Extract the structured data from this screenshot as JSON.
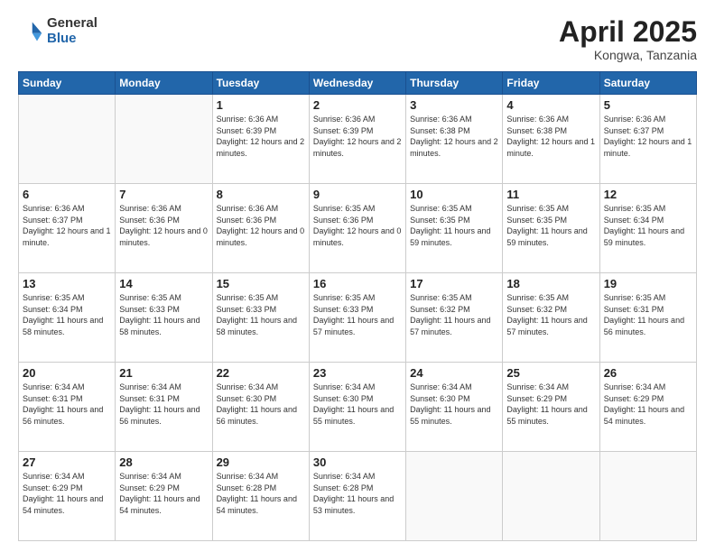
{
  "header": {
    "logo_general": "General",
    "logo_blue": "Blue",
    "title": "April 2025",
    "subtitle": "Kongwa, Tanzania"
  },
  "weekdays": [
    "Sunday",
    "Monday",
    "Tuesday",
    "Wednesday",
    "Thursday",
    "Friday",
    "Saturday"
  ],
  "weeks": [
    [
      {
        "day": "",
        "empty": true
      },
      {
        "day": "",
        "empty": true
      },
      {
        "day": "1",
        "sunrise": "6:36 AM",
        "sunset": "6:39 PM",
        "daylight": "12 hours and 2 minutes."
      },
      {
        "day": "2",
        "sunrise": "6:36 AM",
        "sunset": "6:39 PM",
        "daylight": "12 hours and 2 minutes."
      },
      {
        "day": "3",
        "sunrise": "6:36 AM",
        "sunset": "6:38 PM",
        "daylight": "12 hours and 2 minutes."
      },
      {
        "day": "4",
        "sunrise": "6:36 AM",
        "sunset": "6:38 PM",
        "daylight": "12 hours and 1 minute."
      },
      {
        "day": "5",
        "sunrise": "6:36 AM",
        "sunset": "6:37 PM",
        "daylight": "12 hours and 1 minute."
      }
    ],
    [
      {
        "day": "6",
        "sunrise": "6:36 AM",
        "sunset": "6:37 PM",
        "daylight": "12 hours and 1 minute."
      },
      {
        "day": "7",
        "sunrise": "6:36 AM",
        "sunset": "6:36 PM",
        "daylight": "12 hours and 0 minutes."
      },
      {
        "day": "8",
        "sunrise": "6:36 AM",
        "sunset": "6:36 PM",
        "daylight": "12 hours and 0 minutes."
      },
      {
        "day": "9",
        "sunrise": "6:35 AM",
        "sunset": "6:36 PM",
        "daylight": "12 hours and 0 minutes."
      },
      {
        "day": "10",
        "sunrise": "6:35 AM",
        "sunset": "6:35 PM",
        "daylight": "11 hours and 59 minutes."
      },
      {
        "day": "11",
        "sunrise": "6:35 AM",
        "sunset": "6:35 PM",
        "daylight": "11 hours and 59 minutes."
      },
      {
        "day": "12",
        "sunrise": "6:35 AM",
        "sunset": "6:34 PM",
        "daylight": "11 hours and 59 minutes."
      }
    ],
    [
      {
        "day": "13",
        "sunrise": "6:35 AM",
        "sunset": "6:34 PM",
        "daylight": "11 hours and 58 minutes."
      },
      {
        "day": "14",
        "sunrise": "6:35 AM",
        "sunset": "6:33 PM",
        "daylight": "11 hours and 58 minutes."
      },
      {
        "day": "15",
        "sunrise": "6:35 AM",
        "sunset": "6:33 PM",
        "daylight": "11 hours and 58 minutes."
      },
      {
        "day": "16",
        "sunrise": "6:35 AM",
        "sunset": "6:33 PM",
        "daylight": "11 hours and 57 minutes."
      },
      {
        "day": "17",
        "sunrise": "6:35 AM",
        "sunset": "6:32 PM",
        "daylight": "11 hours and 57 minutes."
      },
      {
        "day": "18",
        "sunrise": "6:35 AM",
        "sunset": "6:32 PM",
        "daylight": "11 hours and 57 minutes."
      },
      {
        "day": "19",
        "sunrise": "6:35 AM",
        "sunset": "6:31 PM",
        "daylight": "11 hours and 56 minutes."
      }
    ],
    [
      {
        "day": "20",
        "sunrise": "6:34 AM",
        "sunset": "6:31 PM",
        "daylight": "11 hours and 56 minutes."
      },
      {
        "day": "21",
        "sunrise": "6:34 AM",
        "sunset": "6:31 PM",
        "daylight": "11 hours and 56 minutes."
      },
      {
        "day": "22",
        "sunrise": "6:34 AM",
        "sunset": "6:30 PM",
        "daylight": "11 hours and 56 minutes."
      },
      {
        "day": "23",
        "sunrise": "6:34 AM",
        "sunset": "6:30 PM",
        "daylight": "11 hours and 55 minutes."
      },
      {
        "day": "24",
        "sunrise": "6:34 AM",
        "sunset": "6:30 PM",
        "daylight": "11 hours and 55 minutes."
      },
      {
        "day": "25",
        "sunrise": "6:34 AM",
        "sunset": "6:29 PM",
        "daylight": "11 hours and 55 minutes."
      },
      {
        "day": "26",
        "sunrise": "6:34 AM",
        "sunset": "6:29 PM",
        "daylight": "11 hours and 54 minutes."
      }
    ],
    [
      {
        "day": "27",
        "sunrise": "6:34 AM",
        "sunset": "6:29 PM",
        "daylight": "11 hours and 54 minutes."
      },
      {
        "day": "28",
        "sunrise": "6:34 AM",
        "sunset": "6:29 PM",
        "daylight": "11 hours and 54 minutes."
      },
      {
        "day": "29",
        "sunrise": "6:34 AM",
        "sunset": "6:28 PM",
        "daylight": "11 hours and 54 minutes."
      },
      {
        "day": "30",
        "sunrise": "6:34 AM",
        "sunset": "6:28 PM",
        "daylight": "11 hours and 53 minutes."
      },
      {
        "day": "",
        "empty": true
      },
      {
        "day": "",
        "empty": true
      },
      {
        "day": "",
        "empty": true
      }
    ]
  ]
}
